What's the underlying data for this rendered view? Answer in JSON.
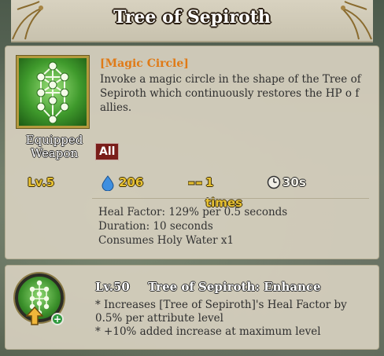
{
  "title": "Tree of Sepiroth",
  "skill": {
    "type_label": "[Magic Circle]",
    "description": "Invoke a magic circle in the shape of the Tree of Sepiroth which continuously restores the HP o f allies.",
    "equip_label_line1": "Equipped",
    "equip_label_line2": "Weapon",
    "target_badge": "All",
    "level": "Lv.5",
    "cost": "206",
    "cost_icon": "water-drop-icon",
    "casts": "1 times",
    "casts_icon": "dash-icon",
    "cooldown": "30s",
    "cooldown_icon": "clock-icon",
    "effects": [
      "Heal Factor: 129% per 0.5 seconds",
      "Duration: 10 seconds",
      "Consumes Holy Water x1"
    ]
  },
  "enhance": {
    "level": "Lv.50",
    "name": "Tree of Sepiroth: Enhance",
    "lines": [
      "* Increases [Tree of Sepiroth]'s Heal Factor by",
      "0.5% per attribute level",
      "* +10% added increase at maximum level"
    ],
    "plus_symbol": "+"
  },
  "colors": {
    "accent_gold": "#e8c233",
    "type_orange": "#e07a16",
    "badge_red": "#7a1e1a",
    "icon_green": "#3f9a2c"
  }
}
